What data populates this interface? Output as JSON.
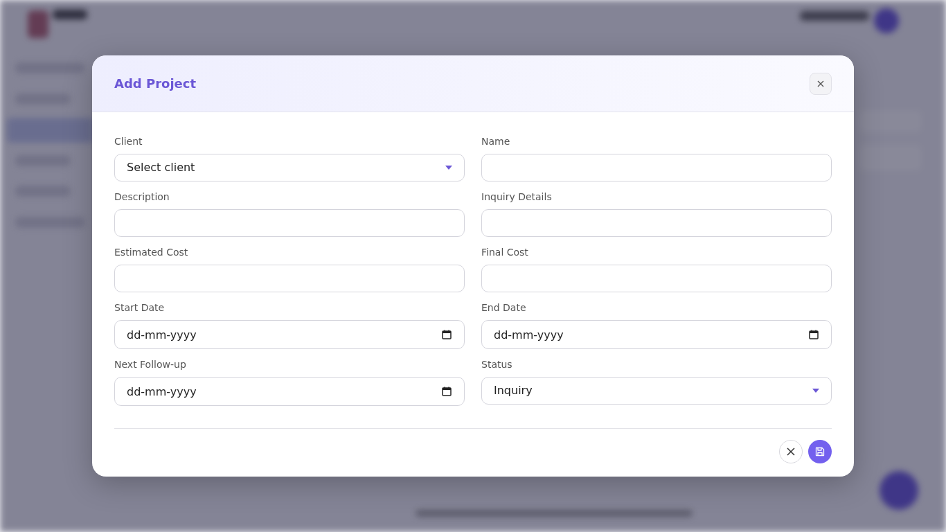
{
  "modal": {
    "title": "Add Project",
    "fields": [
      {
        "kind": "select",
        "label": "Client",
        "value": "Select client"
      },
      {
        "kind": "text",
        "label": "Name"
      },
      {
        "kind": "text",
        "label": "Description"
      },
      {
        "kind": "text",
        "label": "Inquiry Details"
      },
      {
        "kind": "text",
        "label": "Estimated Cost"
      },
      {
        "kind": "text",
        "label": "Final Cost"
      },
      {
        "kind": "date",
        "label": "Start Date",
        "placeholder": "dd-mm-yyyy"
      },
      {
        "kind": "date",
        "label": "End Date",
        "placeholder": "dd-mm-yyyy"
      },
      {
        "kind": "date",
        "label": "Next Follow-up",
        "placeholder": "dd-mm-yyyy"
      },
      {
        "kind": "select",
        "label": "Status",
        "value": "Inquiry"
      }
    ]
  }
}
